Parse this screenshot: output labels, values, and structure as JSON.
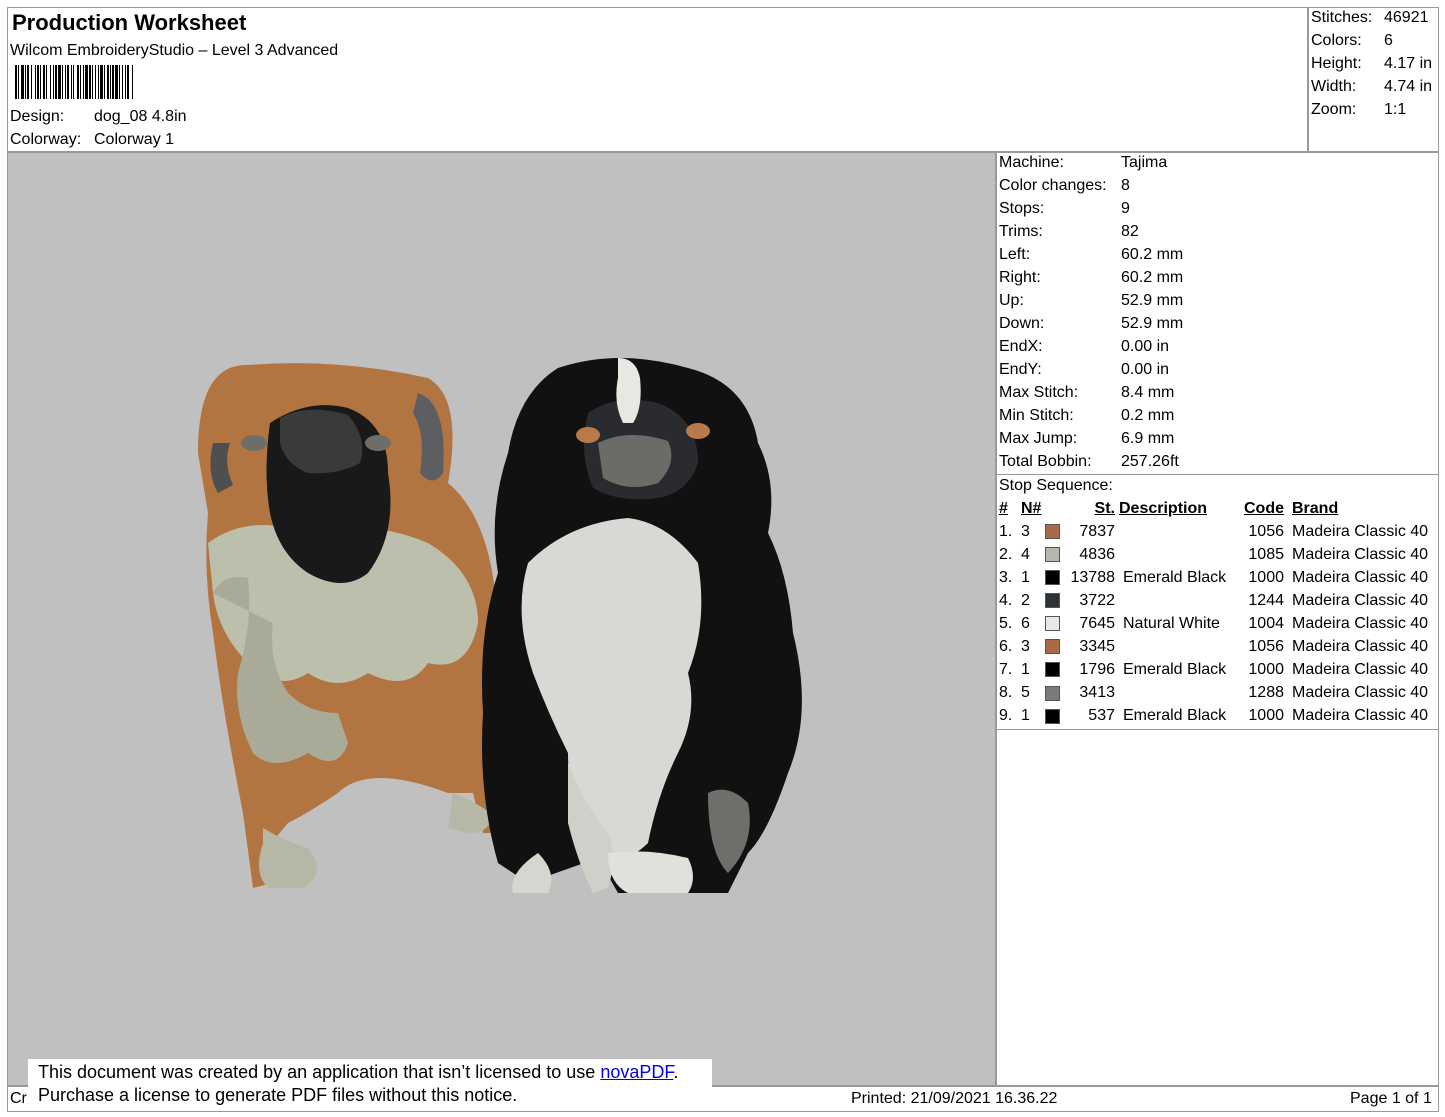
{
  "header": {
    "title": "Production Worksheet",
    "software": "Wilcom EmbroideryStudio – Level 3 Advanced",
    "design_label": "Design:",
    "design_value": "dog_08 4.8in",
    "colorway_label": "Colorway:",
    "colorway_value": "Colorway 1"
  },
  "summary": [
    {
      "label": "Stitches:",
      "value": "46921"
    },
    {
      "label": "Colors:",
      "value": "6"
    },
    {
      "label": "Height:",
      "value": "4.17 in"
    },
    {
      "label": "Width:",
      "value": "4.74 in"
    },
    {
      "label": "Zoom:",
      "value": "1:1"
    }
  ],
  "machine_info": [
    {
      "label": "Machine:",
      "value": "Tajima"
    },
    {
      "label": "Color changes:",
      "value": "8"
    },
    {
      "label": "Stops:",
      "value": "9"
    },
    {
      "label": "Trims:",
      "value": "82"
    },
    {
      "label": "Left:",
      "value": "60.2 mm"
    },
    {
      "label": "Right:",
      "value": "60.2 mm"
    },
    {
      "label": "Up:",
      "value": "52.9 mm"
    },
    {
      "label": "Down:",
      "value": "52.9 mm"
    },
    {
      "label": "EndX:",
      "value": "0.00 in"
    },
    {
      "label": "EndY:",
      "value": "0.00 in"
    },
    {
      "label": "Max Stitch:",
      "value": "8.4 mm"
    },
    {
      "label": "Min Stitch:",
      "value": "0.2 mm"
    },
    {
      "label": "Max Jump:",
      "value": "6.9 mm"
    },
    {
      "label": "Total Bobbin:",
      "value": "257.26ft"
    }
  ],
  "stop_sequence": {
    "title": "Stop Sequence:",
    "columns": [
      "#",
      "N#",
      "St.",
      "Description",
      "Code",
      "Brand"
    ],
    "rows": [
      {
        "num": "1.",
        "n": "3",
        "color": "#a86b45",
        "st": "7837",
        "desc": "",
        "code": "1056",
        "brand": "Madeira Classic 40"
      },
      {
        "num": "2.",
        "n": "4",
        "color": "#b8b5ac",
        "st": "4836",
        "desc": "",
        "code": "1085",
        "brand": "Madeira Classic 40"
      },
      {
        "num": "3.",
        "n": "1",
        "color": "#000000",
        "st": "13788",
        "desc": "Emerald Black",
        "code": "1000",
        "brand": "Madeira Classic 40"
      },
      {
        "num": "4.",
        "n": "2",
        "color": "#2e3136",
        "st": "3722",
        "desc": "",
        "code": "1244",
        "brand": "Madeira Classic 40"
      },
      {
        "num": "5.",
        "n": "6",
        "color": "#e6e8ee",
        "st": "7645",
        "desc": "Natural White",
        "code": "1004",
        "brand": "Madeira Classic 40"
      },
      {
        "num": "6.",
        "n": "3",
        "color": "#a86b45",
        "st": "3345",
        "desc": "",
        "code": "1056",
        "brand": "Madeira Classic 40"
      },
      {
        "num": "7.",
        "n": "1",
        "color": "#000000",
        "st": "1796",
        "desc": "Emerald Black",
        "code": "1000",
        "brand": "Madeira Classic 40"
      },
      {
        "num": "8.",
        "n": "5",
        "color": "#7a7a7a",
        "st": "3413",
        "desc": "",
        "code": "1288",
        "brand": "Madeira Classic 40"
      },
      {
        "num": "9.",
        "n": "1",
        "color": "#000000",
        "st": "537",
        "desc": "Emerald Black",
        "code": "1000",
        "brand": "Madeira Classic 40"
      }
    ]
  },
  "footer": {
    "left_fragment": "Cr",
    "printed": "Printed: 21/09/2021 16.36.22",
    "page": "Page 1 of 1"
  },
  "notice": {
    "line1_prefix": "This document was created by an application that isn’t licensed to use ",
    "link": "novaPDF",
    "line1_suffix": ".",
    "line2": "Purchase a license to generate PDF files without this notice."
  },
  "colors": {
    "preview_bg": "#c0c0c0",
    "link": "#0000ee"
  }
}
